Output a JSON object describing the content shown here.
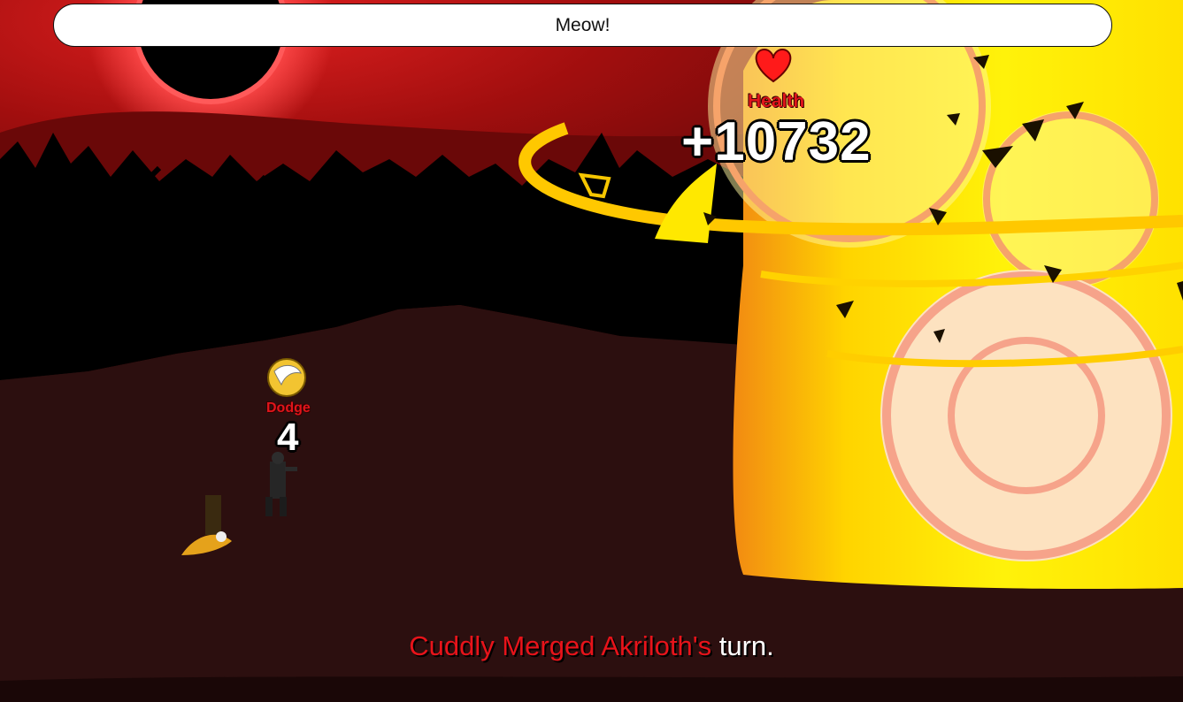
{
  "speech_bubble": {
    "text": "Meow!"
  },
  "health_popup": {
    "label": "Health",
    "value": "+10732"
  },
  "dodge_popup": {
    "label": "Dodge",
    "value": "4"
  },
  "turn_message": {
    "name": "Cuddly Merged Akriloth's",
    "suffix": " turn."
  },
  "icons": {
    "health": "heart-icon",
    "dodge": "wing-icon"
  },
  "colors": {
    "sky": "#7a0c0c",
    "ground": "#2a0f0f",
    "fire": "#ffe600",
    "fire_orange": "#f39a1a",
    "label_red": "#e0151b"
  }
}
